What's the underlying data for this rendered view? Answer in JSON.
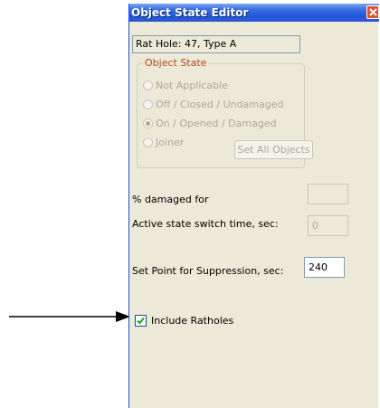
{
  "window": {
    "title": "Object State Editor",
    "close_icon": "close-icon"
  },
  "object_name": "Rat Hole: 47, Type A",
  "object_state": {
    "legend": "Object State",
    "options": [
      {
        "label": "Not Applicable",
        "selected": false
      },
      {
        "label": "Off / Closed / Undamaged",
        "selected": false
      },
      {
        "label": "On / Opened / Damaged",
        "selected": true
      },
      {
        "label": "Joiner",
        "selected": false
      }
    ],
    "set_all_label": "Set All Objects"
  },
  "fields": {
    "damaged_label": "% damaged for",
    "damaged_value": "",
    "switch_time_label": "Active state switch time, sec:",
    "switch_time_value": "0",
    "suppression_label": "Set Point for Suppression, sec:",
    "suppression_value": "240"
  },
  "include_ratholes": {
    "label": "Include Ratholes",
    "checked": true
  },
  "colors": {
    "title_bar": "#2456d8",
    "window_bg": "#ece9d8",
    "legend_text": "#b04a1a",
    "disabled_text": "#aca899",
    "checkmark": "#21a121"
  }
}
